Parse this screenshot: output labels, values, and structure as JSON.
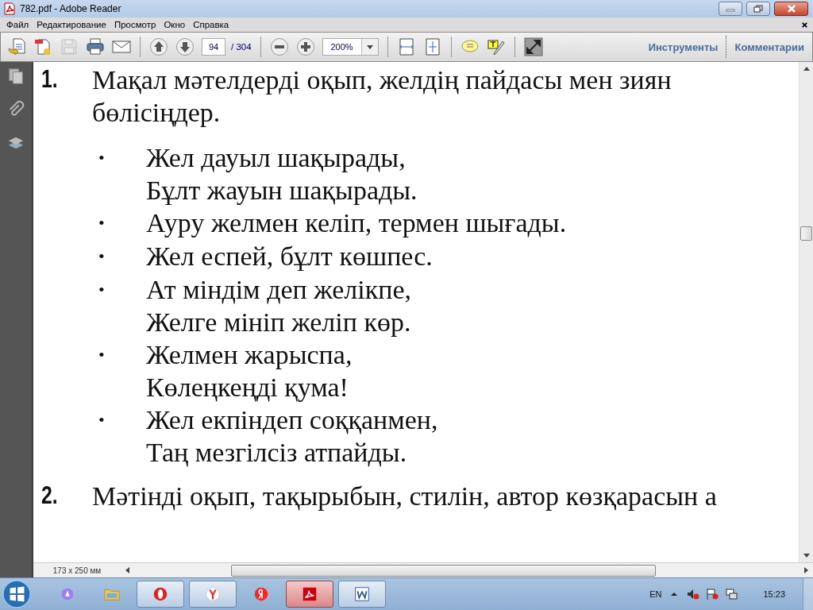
{
  "window": {
    "title": "782.pdf - Adobe Reader"
  },
  "menu": [
    "Файл",
    "Редактирование",
    "Просмотр",
    "Окно",
    "Справка"
  ],
  "toolbar": {
    "page_number": "94",
    "page_total": "/ 304",
    "zoom": "200%",
    "panels": [
      {
        "label": "Инструменты"
      },
      {
        "label": "Комментарии"
      }
    ]
  },
  "document": {
    "sections": [
      {
        "number": "1.",
        "lines": [
          "Мақал мәтелдерді оқып, желдің пайдасы мен зиян",
          "бөлісіңдер."
        ],
        "items": [
          {
            "bullet": "•",
            "lines": [
              "Жел дауыл шақырады,",
              "Бұлт жауын шақырады."
            ]
          },
          {
            "bullet": "•",
            "lines": [
              "Ауру желмен келіп, термен шығады."
            ]
          },
          {
            "bullet": "•",
            "lines": [
              "Жел еспей, бұлт көшпес."
            ]
          },
          {
            "bullet": "•",
            "lines": [
              "Ат міндім деп желікпе,",
              "Желге мініп желіп көр."
            ]
          },
          {
            "bullet": "•",
            "lines": [
              "Желмен жарыспа,",
              "Көлеңкеңді қума!"
            ]
          },
          {
            "bullet": "•",
            "lines": [
              "Жел екпіндеп соққанмен,",
              "Таң мезгілсіз атпайды."
            ]
          }
        ]
      },
      {
        "number": "2.",
        "lines": [
          "Мәтінді оқып, тақырыбын, стилін, автор көзқарасын а"
        ]
      }
    ]
  },
  "page_size": "173 x 250 мм",
  "taskbar": {
    "apps": [
      {
        "kind": "alice",
        "selected": false
      },
      {
        "kind": "folder",
        "selected": false
      },
      {
        "kind": "opera",
        "selected": false
      },
      {
        "kind": "yandex-browser",
        "selected": false
      },
      {
        "kind": "yandex",
        "selected": false
      },
      {
        "kind": "pdf",
        "selected": true
      },
      {
        "kind": "word",
        "selected": false
      }
    ],
    "language": "EN",
    "time": "15:23"
  }
}
